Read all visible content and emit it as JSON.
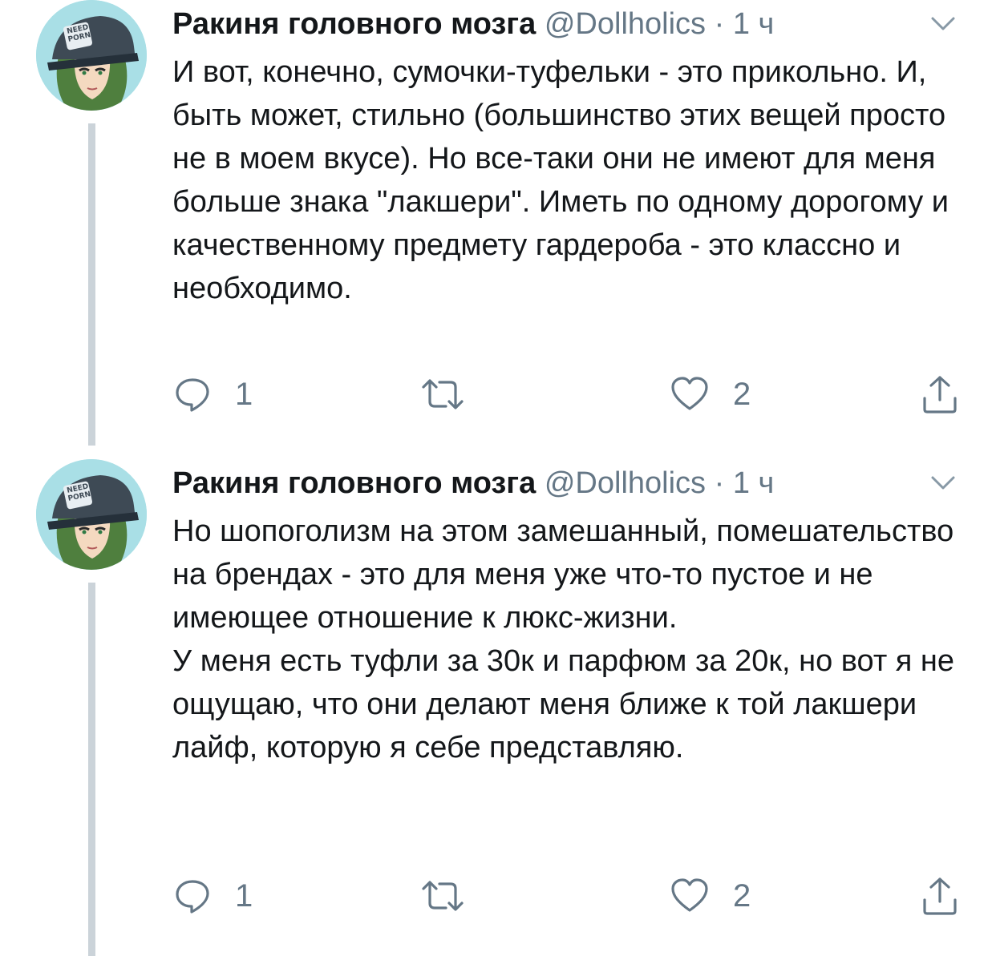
{
  "tweets": [
    {
      "author": "Ракиня головного мозга",
      "handle": "@Dollholics",
      "separator": "·",
      "time": "1 ч",
      "avatar_icon": "avatar-need-porn-cap-icon",
      "avatar_cap_text": "NEED PORN",
      "paragraphs": [
        "И вот, конечно, сумочки-туфельки - это прикольно. И, быть может, стильно (большинство этих вещей просто не в моем вкусе). Но все-таки они не имеют для меня больше знака \"лакшери\". Иметь по одному дорогому и качественному предмету гардероба - это классно и необходимо."
      ],
      "reply_count": "1",
      "retweet_count": "",
      "like_count": "2"
    },
    {
      "author": "Ракиня головного мозга",
      "handle": "@Dollholics",
      "separator": "·",
      "time": "1 ч",
      "avatar_icon": "avatar-need-porn-cap-icon",
      "avatar_cap_text": "NEED PORN",
      "paragraphs": [
        "Но шопоголизм на этом замешанный, помешательство на брендах - это для меня уже что-то пустое и не имеющее отношение к люкс-жизни.",
        "У меня есть туфли за 30к и парфюм за 20к, но вот я не ощущаю, что они делают меня ближе к той лакшери лайф, которую я себе представляю."
      ],
      "reply_count": "1",
      "retweet_count": "",
      "like_count": "2"
    }
  ],
  "icons": {
    "reply": "reply-icon",
    "retweet": "retweet-icon",
    "like": "heart-icon",
    "share": "share-icon",
    "menu": "chevron-down-icon"
  },
  "colors": {
    "text": "#14171a",
    "secondary": "#657786",
    "thread_line": "#cbd3d9",
    "avatar_bg": "#a9dfe6"
  }
}
